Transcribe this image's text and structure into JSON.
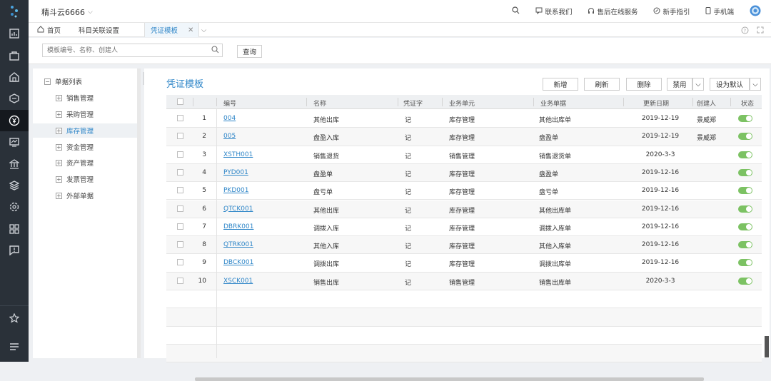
{
  "app": {
    "brand": "精斗云6666"
  },
  "top_links": [
    {
      "icon": "message-icon",
      "label": "联系我们"
    },
    {
      "icon": "headset-icon",
      "label": "售后在线服务"
    },
    {
      "icon": "compass-icon",
      "label": "新手指引"
    },
    {
      "icon": "phone-icon",
      "label": "手机端"
    }
  ],
  "tabs": [
    {
      "label": "首页",
      "icon": "home-icon"
    },
    {
      "label": "科目关联设置"
    },
    {
      "label": "凭证模板",
      "active": true
    }
  ],
  "search": {
    "placeholder": "模板编号、名称、创建人",
    "button": "查询"
  },
  "tree": {
    "root": "单据列表",
    "items": [
      "销售管理",
      "采购管理",
      "库存管理",
      "资金管理",
      "资产管理",
      "发票管理",
      "外部单据"
    ],
    "selected_index": 2
  },
  "panel": {
    "title": "凭证模板"
  },
  "actions": {
    "add": "新增",
    "refresh": "刷新",
    "delete": "删除",
    "disable": "禁用",
    "set_default": "设为默认"
  },
  "table": {
    "headers": [
      "编号",
      "名称",
      "凭证字",
      "业务单元",
      "业务单据",
      "更新日期",
      "创建人",
      "状态"
    ],
    "rows": [
      {
        "n": "1",
        "code": "004",
        "name": "其他出库",
        "word": "记",
        "unit": "库存管理",
        "doc": "其他出库单",
        "date": "2019-12-19",
        "creator": "景威郑"
      },
      {
        "n": "2",
        "code": "005",
        "name": "盘盈入库",
        "word": "记",
        "unit": "库存管理",
        "doc": "盘盈单",
        "date": "2019-12-19",
        "creator": "景威郑"
      },
      {
        "n": "3",
        "code": "XSTH001",
        "name": "销售退货",
        "word": "记",
        "unit": "销售管理",
        "doc": "销售退货单",
        "date": "2020-3-3",
        "creator": ""
      },
      {
        "n": "4",
        "code": "PYD001",
        "name": "盘盈单",
        "word": "记",
        "unit": "库存管理",
        "doc": "盘盈单",
        "date": "2019-12-16",
        "creator": ""
      },
      {
        "n": "5",
        "code": "PKD001",
        "name": "盘亏单",
        "word": "记",
        "unit": "库存管理",
        "doc": "盘亏单",
        "date": "2019-12-16",
        "creator": ""
      },
      {
        "n": "6",
        "code": "QTCK001",
        "name": "其他出库",
        "word": "记",
        "unit": "库存管理",
        "doc": "其他出库单",
        "date": "2019-12-16",
        "creator": ""
      },
      {
        "n": "7",
        "code": "DBRK001",
        "name": "调拨入库",
        "word": "记",
        "unit": "库存管理",
        "doc": "调拨入库单",
        "date": "2019-12-16",
        "creator": ""
      },
      {
        "n": "8",
        "code": "QTRK001",
        "name": "其他入库",
        "word": "记",
        "unit": "库存管理",
        "doc": "其他入库单",
        "date": "2019-12-16",
        "creator": ""
      },
      {
        "n": "9",
        "code": "DBCK001",
        "name": "调拨出库",
        "word": "记",
        "unit": "库存管理",
        "doc": "调拨出库单",
        "date": "2019-12-16",
        "creator": ""
      },
      {
        "n": "10",
        "code": "XSCK001",
        "name": "销售出库",
        "word": "记",
        "unit": "销售管理",
        "doc": "销售出库单",
        "date": "2020-3-3",
        "creator": ""
      }
    ]
  },
  "colors": {
    "accent": "#2f86c8",
    "rail": "#2a3139",
    "toggle_on": "#7cc263"
  }
}
